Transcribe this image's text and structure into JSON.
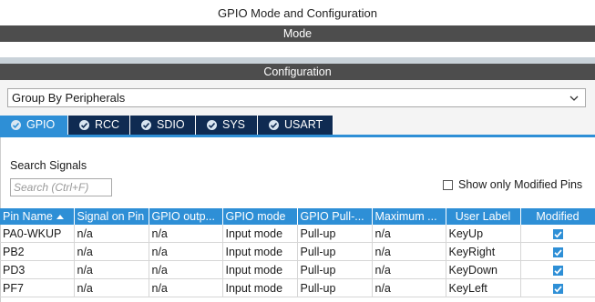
{
  "window": {
    "title": "GPIO Mode and Configuration"
  },
  "sections": {
    "mode": "Mode",
    "configuration": "Configuration"
  },
  "group_select": {
    "value": "Group By Peripherals"
  },
  "tabs": [
    {
      "label": "GPIO",
      "active": true
    },
    {
      "label": "RCC",
      "active": false
    },
    {
      "label": "SDIO",
      "active": false
    },
    {
      "label": "SYS",
      "active": false
    },
    {
      "label": "USART",
      "active": false
    }
  ],
  "search": {
    "label": "Search Signals",
    "placeholder": "Search (Ctrl+F)",
    "value": ""
  },
  "modified_only": {
    "label": "Show only Modified Pins",
    "checked": false
  },
  "table": {
    "headers": [
      "Pin Name",
      "Signal on Pin",
      "GPIO outp...",
      "GPIO mode",
      "GPIO Pull-...",
      "Maximum ...",
      "User Label",
      "Modified"
    ],
    "rows": [
      {
        "pin": "PA0-WKUP",
        "signal": "n/a",
        "output": "n/a",
        "mode": "Input mode",
        "pull": "Pull-up",
        "maximum": "n/a",
        "label": "KeyUp",
        "modified": true
      },
      {
        "pin": "PB2",
        "signal": "n/a",
        "output": "n/a",
        "mode": "Input mode",
        "pull": "Pull-up",
        "maximum": "n/a",
        "label": "KeyRight",
        "modified": true
      },
      {
        "pin": "PD3",
        "signal": "n/a",
        "output": "n/a",
        "mode": "Input mode",
        "pull": "Pull-up",
        "maximum": "n/a",
        "label": "KeyDown",
        "modified": true
      },
      {
        "pin": "PF7",
        "signal": "n/a",
        "output": "n/a",
        "mode": "Input mode",
        "pull": "Pull-up",
        "maximum": "n/a",
        "label": "KeyLeft",
        "modified": true
      }
    ]
  },
  "colors": {
    "accent": "#2e8fd6",
    "tab_inactive": "#0f2b52",
    "section_band": "#4d4d4d"
  }
}
